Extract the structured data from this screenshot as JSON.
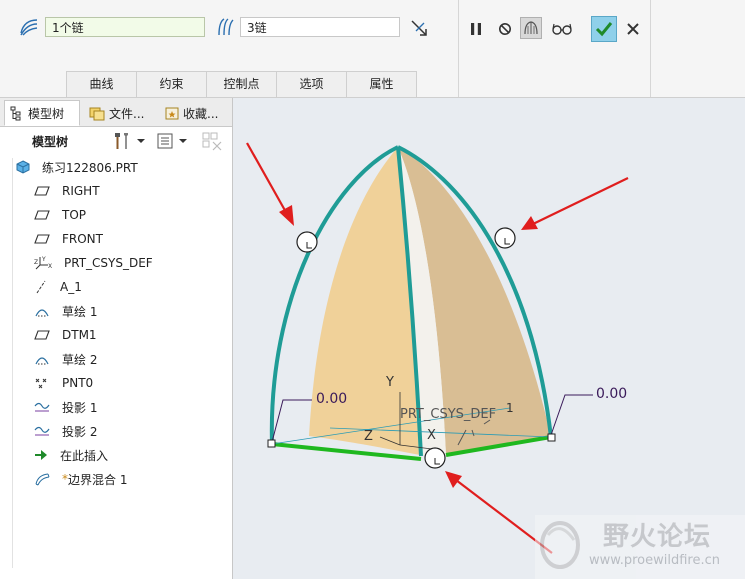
{
  "ribbon": {
    "chain_field_1": "1个链",
    "chain_field_2": "3链",
    "tabs": [
      {
        "label": "曲线"
      },
      {
        "label": "约束"
      },
      {
        "label": "控制点"
      },
      {
        "label": "选项"
      },
      {
        "label": "属性"
      }
    ],
    "controls": [
      "pause-icon",
      "no-icon",
      "preview-geometry-icon",
      "glasses-icon",
      "checkmark-icon",
      "close-icon"
    ]
  },
  "left_panel": {
    "tabs": [
      {
        "label": "模型树",
        "icon": "model-tree-icon"
      },
      {
        "label": "文件...",
        "icon": "folder-icon"
      },
      {
        "label": "收藏...",
        "icon": "favorites-icon"
      }
    ],
    "toolbar_label": "模型树",
    "tree": [
      {
        "label": "练习122806.PRT",
        "icon": "part-icon"
      },
      {
        "label": "RIGHT",
        "icon": "datum-plane-icon"
      },
      {
        "label": "TOP",
        "icon": "datum-plane-icon"
      },
      {
        "label": "FRONT",
        "icon": "datum-plane-icon"
      },
      {
        "label": "PRT_CSYS_DEF",
        "icon": "csys-icon"
      },
      {
        "label": "A_1",
        "icon": "axis-icon"
      },
      {
        "label": "草绘 1",
        "icon": "sketch-icon"
      },
      {
        "label": "DTM1",
        "icon": "datum-plane-icon"
      },
      {
        "label": "草绘 2",
        "icon": "sketch-icon"
      },
      {
        "label": "PNT0",
        "icon": "datum-point-icon"
      },
      {
        "label": "投影 1",
        "icon": "projection-icon"
      },
      {
        "label": "投影 2",
        "icon": "projection-icon"
      },
      {
        "label": "在此插入",
        "icon": "insert-arrow-icon"
      },
      {
        "label": "边界混合 1",
        "icon": "boundary-blend-icon"
      }
    ]
  },
  "viewport": {
    "dim_left": "0.00",
    "dim_right": "0.00",
    "csys_label": "PRT_CSYS_DEF",
    "axis_y": "Y",
    "axis_z": "Z",
    "axis_x": "X",
    "axis_mark": "1",
    "colors": {
      "curve": "#1f9c96",
      "bottom_edge": "#1fb81f",
      "surface_front": "#f0cf95",
      "surface_side": "#d8bb90",
      "arrow": "#e01e1e",
      "dim": "#3a1a5a",
      "background": "#e8ecf1"
    }
  },
  "watermark": {
    "title": "野火论坛",
    "url": "www.proewildfire.cn"
  }
}
